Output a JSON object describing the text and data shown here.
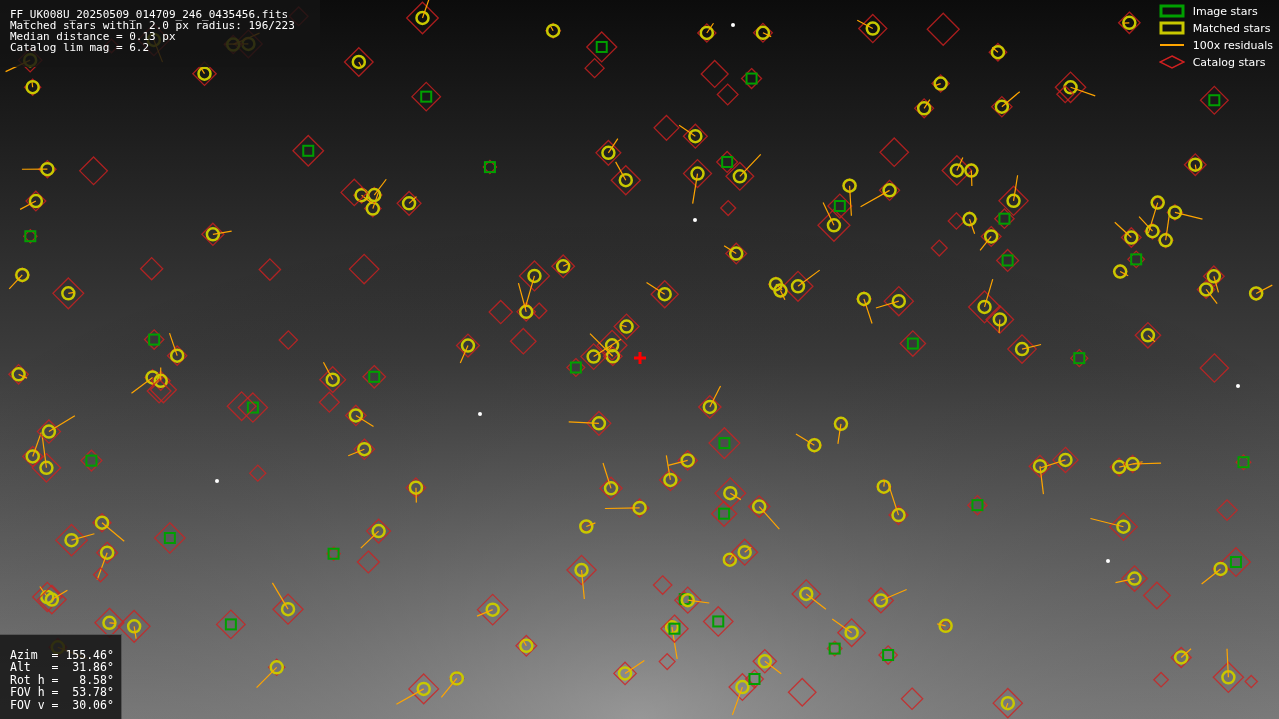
{
  "header_info": {
    "lines": [
      "FF_UK008U_20250509_014709_246_0435456.fits",
      "Matched stars within 2.0 px radius: 196/223",
      "Median distance = 0.13 px",
      "Catalog lim mag = 6.2"
    ]
  },
  "legend": {
    "items": [
      {
        "label": "Image stars",
        "kind": "box",
        "color": "#00a000"
      },
      {
        "label": "Matched stars",
        "kind": "box",
        "color": "#c8c800"
      },
      {
        "label": "100x residuals",
        "kind": "line",
        "color": "#ffa500"
      },
      {
        "label": "Catalog stars",
        "kind": "diamond",
        "color": "#d02020"
      }
    ]
  },
  "pointing_info": {
    "lines": [
      "Azim  = 155.46°",
      "Alt   =  31.86°",
      "Rot h =   8.58°",
      "FOV h =  53.78°",
      "FOV v =  30.06°"
    ]
  }
}
